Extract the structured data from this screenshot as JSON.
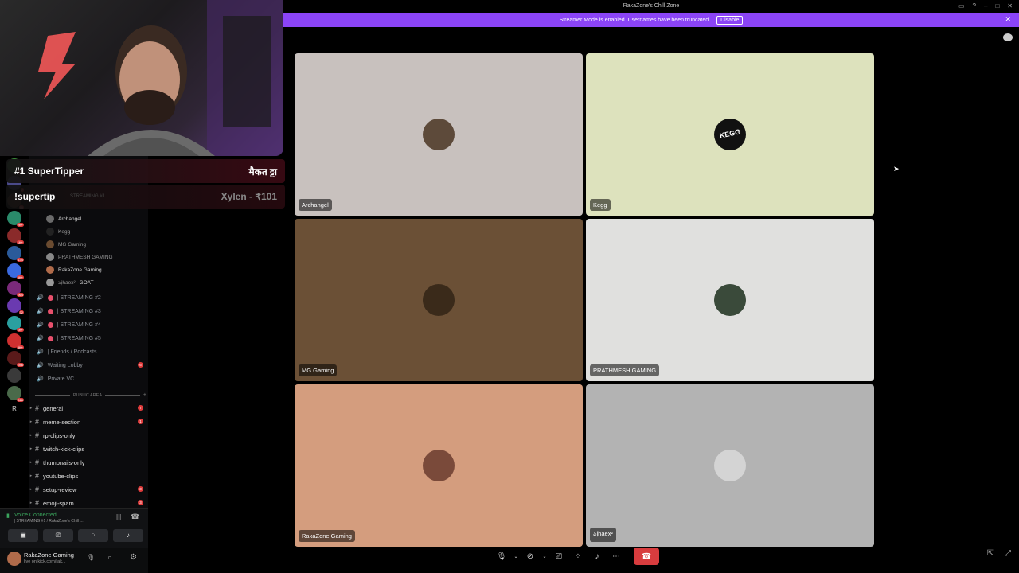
{
  "window": {
    "title": "RakaZone's Chill Zone"
  },
  "banner": {
    "text": "Streamer Mode is enabled. Usernames have been truncated.",
    "button": "Disable"
  },
  "overlay": {
    "supertipper_label": "#1 SuperTipper",
    "supertipper_name": "मैकत ट्टा",
    "command": "!supertip",
    "tip": "Xylen - ₹101",
    "hidden_channel": "STREAMING #1"
  },
  "channels": {
    "members": [
      {
        "name": "Archangel",
        "color": "#6b6b6b"
      },
      {
        "name": "Kegg",
        "color": "#222"
      },
      {
        "name": "MG Gaming",
        "color": "#6a4b30"
      },
      {
        "name": "PRATHMESH GAMING",
        "color": "#888"
      },
      {
        "name": "RakaZone Gaming",
        "color": "#b06b4a"
      },
      {
        "name": "ঌịhaex²",
        "tag": "GOAT",
        "color": "#999"
      }
    ],
    "voice": [
      {
        "name": "| STREAMING #2"
      },
      {
        "name": "| STREAMING #3"
      },
      {
        "name": "| STREAMING #4"
      },
      {
        "name": "| STREAMING #5"
      },
      {
        "name": "| Friends / Podcasts"
      },
      {
        "name": "Waiting Lobby",
        "badge": "6"
      },
      {
        "name": "Private VC"
      }
    ],
    "section": "PUBLIC AREA",
    "text": [
      {
        "name": "general",
        "badge": "7"
      },
      {
        "name": "meme-section",
        "badge": "1"
      },
      {
        "name": "rp-clips-only",
        "badge": ""
      },
      {
        "name": "twitch-kick-clips",
        "badge": ""
      },
      {
        "name": "thumbnails-only",
        "badge": ""
      },
      {
        "name": "youtube-clips",
        "badge": ""
      },
      {
        "name": "setup-review",
        "badge": "3"
      },
      {
        "name": "emoji-spam",
        "badge": "3"
      }
    ]
  },
  "voice_status": {
    "title": "Voice Connected",
    "subtitle": "| STREAMING #1 / RakaZone's Chill ..."
  },
  "user": {
    "name": "RakaZone Gaming",
    "status": "live on kick.com/rak..."
  },
  "servers": [
    {
      "color": "#3a8a3a",
      "badge": "5K+"
    },
    {
      "color": "#4a4a8a",
      "badge": "2"
    },
    {
      "color": "#5a3a2a",
      "badge": "56"
    },
    {
      "color": "#2a8a6a",
      "badge": "2K+"
    },
    {
      "color": "#8a2a2a",
      "badge": "1K+"
    },
    {
      "color": "#2a5a9a",
      "badge": "134"
    },
    {
      "color": "#3a6ae0",
      "badge": "5K+"
    },
    {
      "color": "#7a2a7a",
      "badge": "964"
    },
    {
      "color": "#6a3ab0",
      "badge": "32"
    },
    {
      "color": "#2aa0a0",
      "badge": "1K+"
    },
    {
      "color": "#d03030",
      "badge": "3K+"
    },
    {
      "color": "#5a1a1a",
      "badge": "946"
    },
    {
      "color": "#3a3a3a",
      "badge": ""
    },
    {
      "color": "#4a6a4a",
      "badge": "616"
    }
  ],
  "server_letter": "R",
  "tiles": [
    {
      "name": "Archangel",
      "bg": "#c8c1be",
      "avatar": "#5d4a3a"
    },
    {
      "name": "Kegg",
      "bg": "#dde2bd",
      "avatar": "#111111"
    },
    {
      "name": "MG Gaming",
      "bg": "#6b5036",
      "avatar": "#3a2a1a"
    },
    {
      "name": "PRATHMESH GAMING",
      "bg": "#e0e0de",
      "avatar": "#3a4a3a"
    },
    {
      "name": "RakaZone Gaming",
      "bg": "#d49d7e",
      "avatar": "#7a4a3a"
    },
    {
      "name": "ঌịhaex²",
      "bg": "#b3b3b3",
      "avatar": "#d4d4d4"
    }
  ],
  "kegg_logo_text": "KEGG",
  "colors": {
    "accent": "#8b44f7",
    "end_call": "#d83c3e",
    "badge": "#e03b3b"
  }
}
